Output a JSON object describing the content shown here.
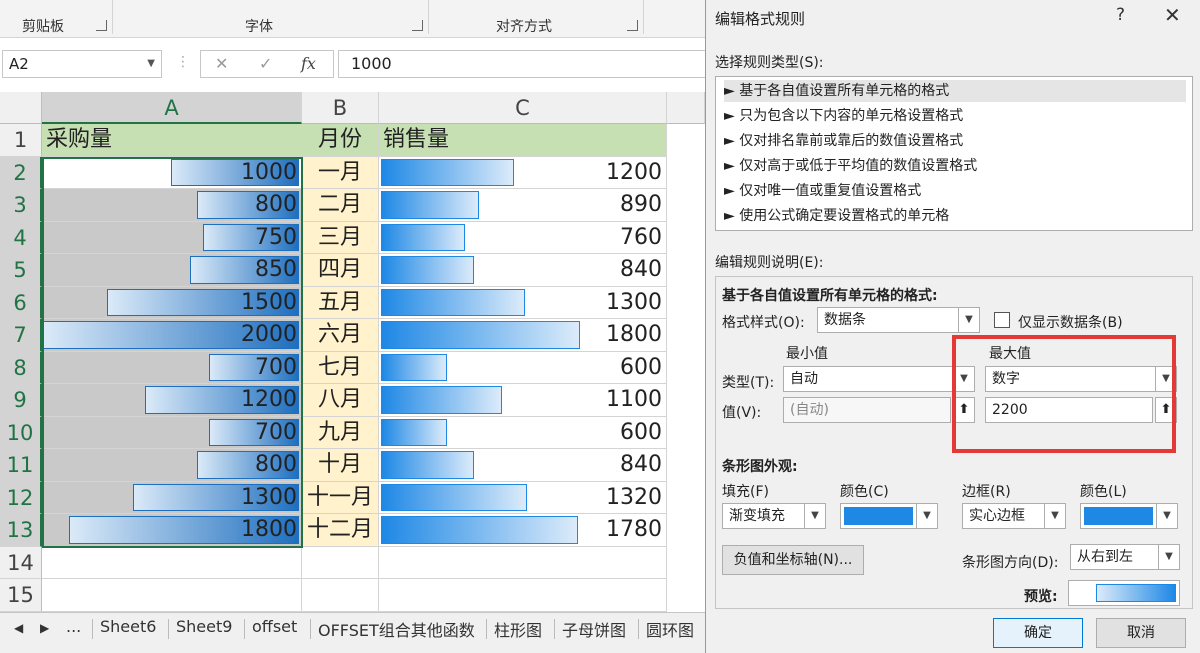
{
  "ribbon": {
    "groups": [
      "剪贴板",
      "字体",
      "对齐方式"
    ]
  },
  "formula_bar": {
    "name_box": "A2",
    "cancel_icon": "✕",
    "enter_icon": "✓",
    "fx": "fx",
    "value": "1000"
  },
  "columns": [
    "A",
    "B",
    "C"
  ],
  "rows": [
    "1",
    "2",
    "3",
    "4",
    "5",
    "6",
    "7",
    "8",
    "9",
    "10",
    "11",
    "12",
    "13",
    "14",
    "15"
  ],
  "table": {
    "headers": [
      "采购量",
      "月份",
      "销售量"
    ],
    "data": [
      {
        "a": "1000",
        "b": "一月",
        "c": "1200"
      },
      {
        "a": "800",
        "b": "二月",
        "c": "890"
      },
      {
        "a": "750",
        "b": "三月",
        "c": "760"
      },
      {
        "a": "850",
        "b": "四月",
        "c": "840"
      },
      {
        "a": "1500",
        "b": "五月",
        "c": "1300"
      },
      {
        "a": "2000",
        "b": "六月",
        "c": "1800"
      },
      {
        "a": "700",
        "b": "七月",
        "c": "600"
      },
      {
        "a": "1200",
        "b": "八月",
        "c": "1100"
      },
      {
        "a": "700",
        "b": "九月",
        "c": "600"
      },
      {
        "a": "800",
        "b": "十月",
        "c": "840"
      },
      {
        "a": "1300",
        "b": "十一月",
        "c": "1320"
      },
      {
        "a": "1800",
        "b": "十二月",
        "c": "1780"
      }
    ],
    "bar_fraction_a": [
      0.5,
      0.4,
      0.375,
      0.425,
      0.75,
      1.0,
      0.35,
      0.6,
      0.35,
      0.4,
      0.65,
      0.9
    ],
    "bar_fraction_c": [
      0.667,
      0.494,
      0.422,
      0.467,
      0.722,
      1.0,
      0.333,
      0.611,
      0.333,
      0.467,
      0.733,
      0.989
    ]
  },
  "sheet_tabs": {
    "nav_left": "◀",
    "nav_right": "▶",
    "more": "...",
    "tabs": [
      "Sheet6",
      "Sheet9",
      "offset",
      "OFFSET组合其他函数",
      "柱形图",
      "子母饼图",
      "圆环图"
    ]
  },
  "dialog": {
    "title": "编辑格式规则",
    "help": "?",
    "close": "✕",
    "select_rule_type_label": "选择规则类型(S):",
    "rule_types": [
      "► 基于各自值设置所有单元格的格式",
      "► 只为包含以下内容的单元格设置格式",
      "► 仅对排名靠前或靠后的数值设置格式",
      "► 仅对高于或低于平均值的数值设置格式",
      "► 仅对唯一值或重复值设置格式",
      "► 使用公式确定要设置格式的单元格"
    ],
    "edit_desc_label": "编辑规则说明(E):",
    "desc_heading": "基于各自值设置所有单元格的格式:",
    "format_style_label": "格式样式(O):",
    "format_style_value": "数据条",
    "show_bar_only_label": "仅显示数据条(B)",
    "min_label": "最小值",
    "max_label": "最大值",
    "type_label": "类型(T):",
    "value_label": "值(V):",
    "min_type": "自动",
    "max_type": "数字",
    "min_value": "(自动)",
    "max_value": "2200",
    "bar_appearance_label": "条形图外观:",
    "fill_label": "填充(F)",
    "fill_value": "渐变填充",
    "color_label": "颜色(C)",
    "border_label": "边框(R)",
    "border_value": "实心边框",
    "border_color_label": "颜色(L)",
    "fill_color": "#1e88e5",
    "border_color": "#1e88e5",
    "neg_axis_button": "负值和坐标轴(N)...",
    "direction_label": "条形图方向(D):",
    "direction_value": "从右到左",
    "preview_label": "预览:",
    "ok": "确定",
    "cancel": "取消",
    "highlight_color": "#e53935"
  }
}
